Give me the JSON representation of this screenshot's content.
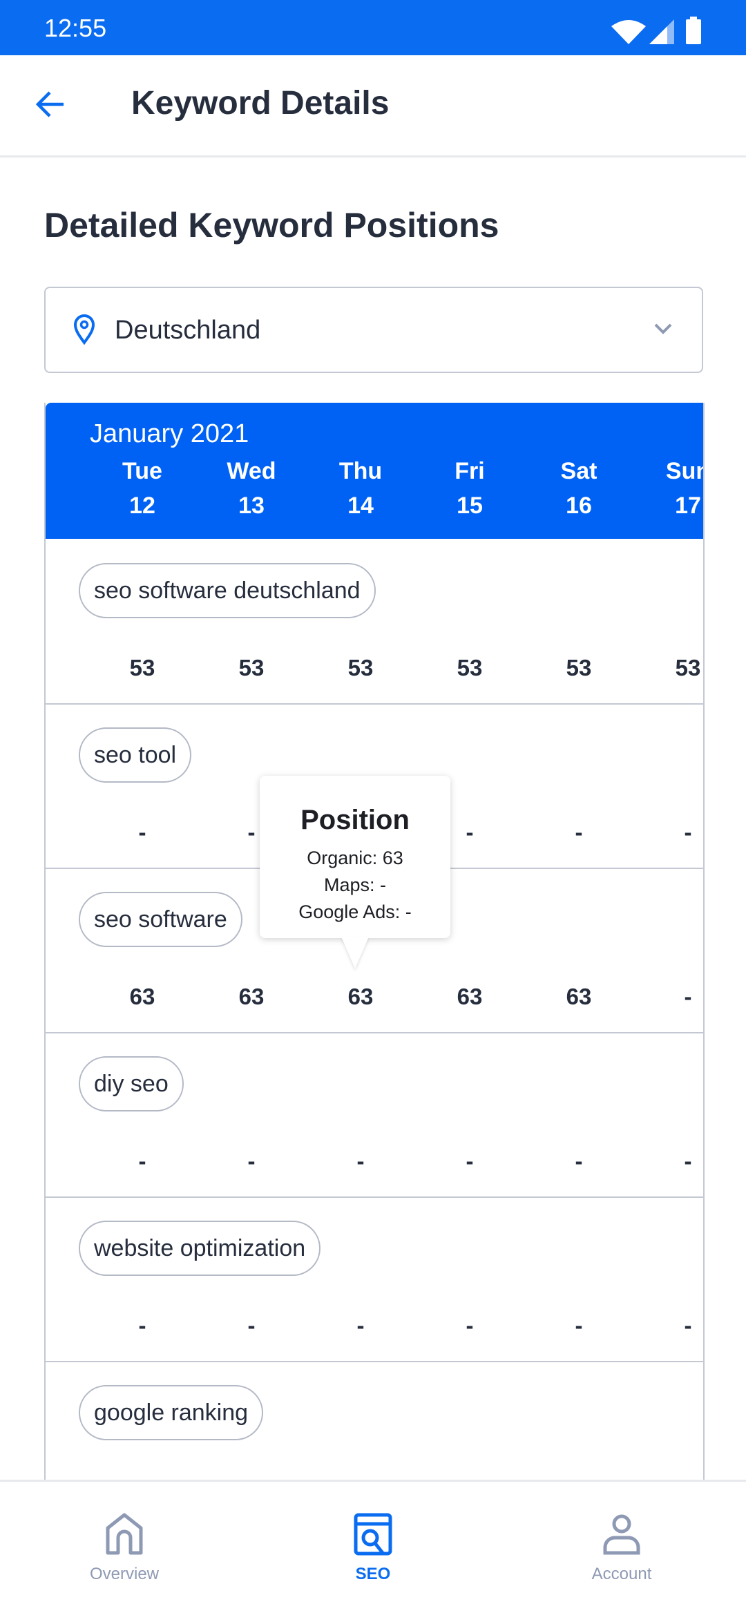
{
  "status_bar": {
    "time": "12:55",
    "icons": [
      "wifi-icon",
      "signal-icon",
      "battery-icon"
    ]
  },
  "app_bar": {
    "back_icon": "arrow-left-icon",
    "title": "Keyword Details"
  },
  "heading": "Detailed Keyword Positions",
  "location_select": {
    "icon": "location-pin-icon",
    "value": "Deutschland",
    "chevron": "chevron-down-icon"
  },
  "calendar": {
    "month": "January 2021",
    "days": [
      {
        "name": "Tue",
        "date": "12"
      },
      {
        "name": "Wed",
        "date": "13"
      },
      {
        "name": "Thu",
        "date": "14"
      },
      {
        "name": "Fri",
        "date": "15"
      },
      {
        "name": "Sat",
        "date": "16"
      },
      {
        "name": "Sun",
        "date": "17"
      }
    ]
  },
  "keywords": [
    {
      "keyword": "seo software deutschland",
      "positions": [
        "53",
        "53",
        "53",
        "53",
        "53",
        "53"
      ]
    },
    {
      "keyword": "seo tool",
      "positions": [
        "-",
        "-",
        "-",
        "-",
        "-",
        "-"
      ]
    },
    {
      "keyword": "seo software",
      "positions": [
        "63",
        "63",
        "63",
        "63",
        "63",
        "-"
      ]
    },
    {
      "keyword": "diy seo",
      "positions": [
        "-",
        "-",
        "-",
        "-",
        "-",
        "-"
      ]
    },
    {
      "keyword": "website optimization",
      "positions": [
        "-",
        "-",
        "-",
        "-",
        "-",
        "-"
      ]
    },
    {
      "keyword": "google ranking",
      "positions": []
    }
  ],
  "tooltip": {
    "title": "Position",
    "organic": "Organic: 63",
    "maps": "Maps: -",
    "google_ads": "Google Ads: -"
  },
  "bottom_nav": [
    {
      "label": "Overview",
      "icon": "home-icon",
      "active": false
    },
    {
      "label": "SEO",
      "icon": "seo-search-icon",
      "active": true
    },
    {
      "label": "Account",
      "icon": "user-icon",
      "active": false
    }
  ],
  "colors": {
    "primary": "#0062f5",
    "status_bar": "#0a6cf0",
    "text": "#262d3d",
    "inactive": "#8e99b3"
  }
}
